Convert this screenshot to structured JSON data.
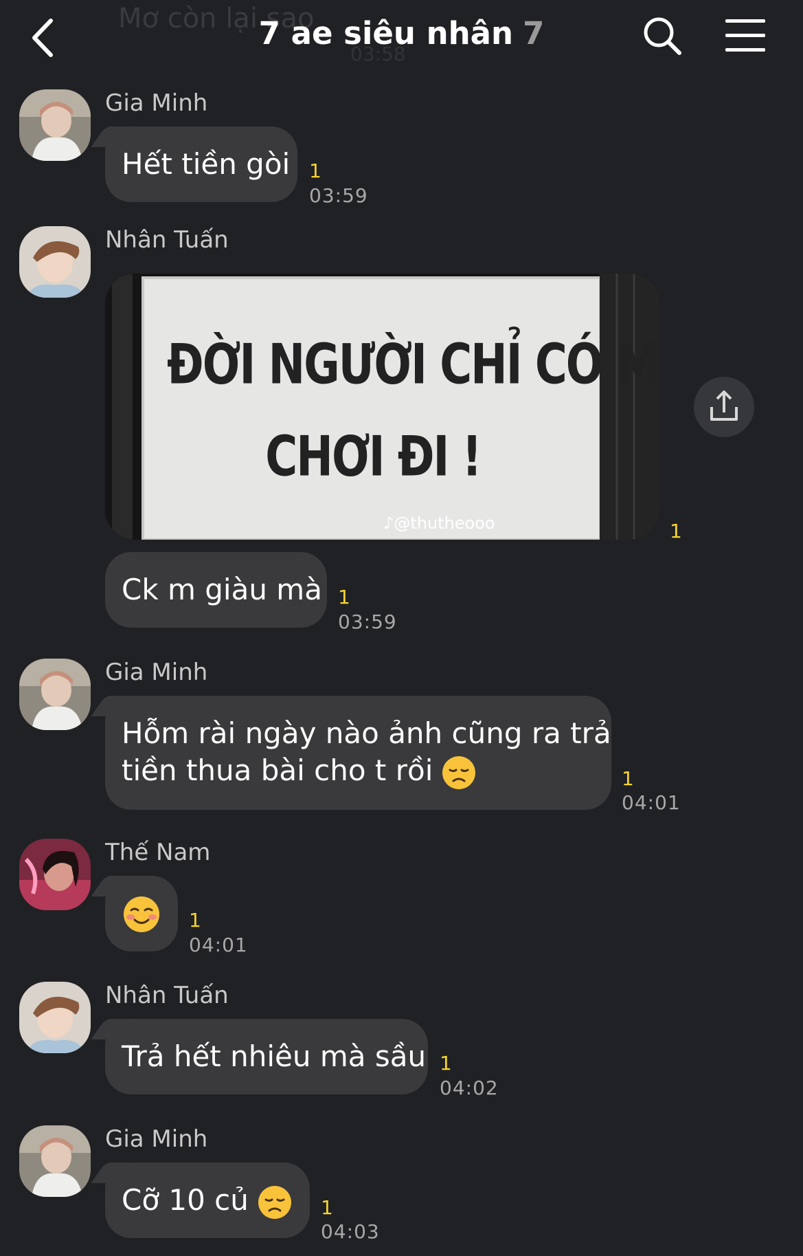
{
  "header": {
    "ghost_text": "Mơ còn lại sao",
    "ghost_time": "03:58",
    "title": "7 ae siêu nhân",
    "member_count": "7"
  },
  "messages": [
    {
      "sender": "Gia Minh",
      "text": "Hết tiền gòi",
      "unread": "1",
      "time": "03:59"
    },
    {
      "sender": "Nhân Tuấn",
      "image_line1": "ĐỜI NGƯỜI CHỈ CÓ MỘT",
      "image_line2": "CHƠI ĐI !",
      "image_watermark": "@thutheooo",
      "unread": "1"
    },
    {
      "text": "Ck m giàu mà",
      "unread": "1",
      "time": "03:59"
    },
    {
      "sender": "Gia Minh",
      "line1": "Hỗm rài ngày nào ảnh cũng ra trả",
      "line2": "tiền thua bài cho t rồi",
      "emoji": "disappointed-face",
      "unread": "1",
      "time": "04:01"
    },
    {
      "sender": "Thế Nam",
      "emoji": "smiling-face",
      "unread": "1",
      "time": "04:01"
    },
    {
      "sender": "Nhân Tuấn",
      "text": "Trả hết nhiêu mà sầu",
      "unread": "1",
      "time": "04:02"
    },
    {
      "sender": "Gia Minh",
      "text": "Cỡ 10 củ",
      "emoji": "disappointed-face",
      "unread": "1",
      "time": "04:03"
    }
  ],
  "icons": {
    "back": "chevron-left-icon",
    "search": "search-icon",
    "menu": "hamburger-menu-icon",
    "share": "share-icon"
  },
  "colors": {
    "background": "#202124",
    "bubble": "#3a3a3d",
    "unread": "#f6d530",
    "title": "#ffffff"
  }
}
